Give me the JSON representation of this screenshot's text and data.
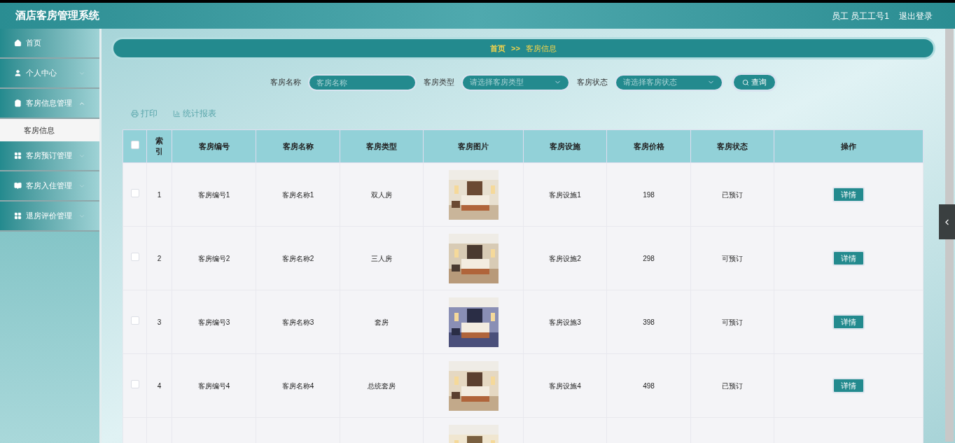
{
  "app_title": "酒店客房管理系统",
  "user": {
    "role": "员工",
    "name": "员工工号1",
    "logout": "退出登录"
  },
  "sidebar": {
    "items": [
      {
        "label": "首页"
      },
      {
        "label": "个人中心",
        "expanded": false
      },
      {
        "label": "客房信息管理",
        "expanded": true,
        "children": [
          {
            "label": "客房信息",
            "selected": true
          }
        ]
      },
      {
        "label": "客房预订管理",
        "expanded": false
      },
      {
        "label": "客房入住管理",
        "expanded": false
      },
      {
        "label": "退房评价管理",
        "expanded": false
      }
    ]
  },
  "breadcrumb": {
    "home": "首页",
    "separator": ">>",
    "current": "客房信息"
  },
  "search": {
    "fields": [
      {
        "kind": "input",
        "label": "客房名称",
        "placeholder": "客房名称"
      },
      {
        "kind": "select",
        "label": "客房类型",
        "placeholder": "请选择客房类型"
      },
      {
        "kind": "select",
        "label": "客房状态",
        "placeholder": "请选择客房状态"
      }
    ],
    "button": "查询"
  },
  "toolbar": [
    {
      "label": "打印"
    },
    {
      "label": "统计报表"
    }
  ],
  "table": {
    "all_checked": false,
    "columns": [
      "索引",
      "客房编号",
      "客房名称",
      "客房类型",
      "客房图片",
      "客房设施",
      "客房价格",
      "客房状态",
      "操作"
    ],
    "rows": [
      {
        "checked": false,
        "index": "1",
        "number": "客房编号1",
        "name": "客房名称1",
        "type": "双人房",
        "image": {
          "kind": "picture"
        },
        "facility": "客房设施1",
        "price": "198",
        "status": "已预订",
        "action": "详情"
      },
      {
        "checked": false,
        "index": "2",
        "number": "客房编号2",
        "name": "客房名称2",
        "type": "三人房",
        "image": {
          "kind": "picture"
        },
        "facility": "客房设施2",
        "price": "298",
        "status": "可预订",
        "action": "详情"
      },
      {
        "checked": false,
        "index": "3",
        "number": "客房编号3",
        "name": "客房名称3",
        "type": "套房",
        "image": {
          "kind": "picture"
        },
        "facility": "客房设施3",
        "price": "398",
        "status": "可预订",
        "action": "详情"
      },
      {
        "checked": false,
        "index": "4",
        "number": "客房编号4",
        "name": "客房名称4",
        "type": "总统套房",
        "image": {
          "kind": "picture"
        },
        "facility": "客房设施4",
        "price": "498",
        "status": "已预订",
        "action": "详情"
      },
      {
        "image": {
          "kind": "picture"
        }
      }
    ]
  }
}
